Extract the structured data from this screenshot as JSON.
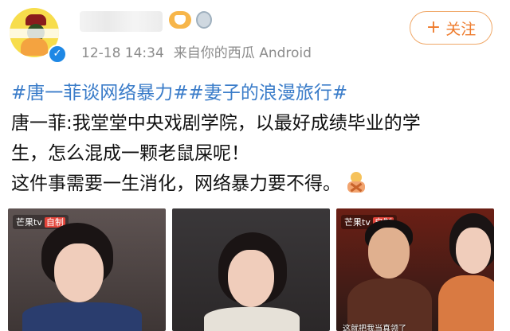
{
  "header": {
    "username": "",
    "timestamp": "12-18 14:34",
    "source": "来自你的西瓜 Android",
    "follow_label": "关注"
  },
  "post": {
    "hashtags": "#唐一菲谈网络暴力##妻子的浪漫旅行#",
    "line1": "唐一菲:我堂堂中央戏剧学院，以最好成绩毕业的学",
    "line2": "生，怎么混成一颗老鼠屎呢！",
    "line3": "这件事需要一生消化，网络暴力要不得。"
  },
  "media": {
    "thumb1_logo": "芒果tv",
    "thumb1_tag": "自制",
    "thumb3_logo": "芒果tv",
    "thumb3_tag": "自制",
    "thumb3_caption": "这就把我当真领了"
  },
  "icons": {
    "avatar": "avatar-cartoon",
    "verify": "verified-badge-icon",
    "level": "level-crown-icon",
    "medal": "medal-icon",
    "emoji": "no-gesture-emoji"
  },
  "colors": {
    "hashtag": "#3a7cc9",
    "follow": "#ee7a2b",
    "meta": "#8c8c8c"
  }
}
